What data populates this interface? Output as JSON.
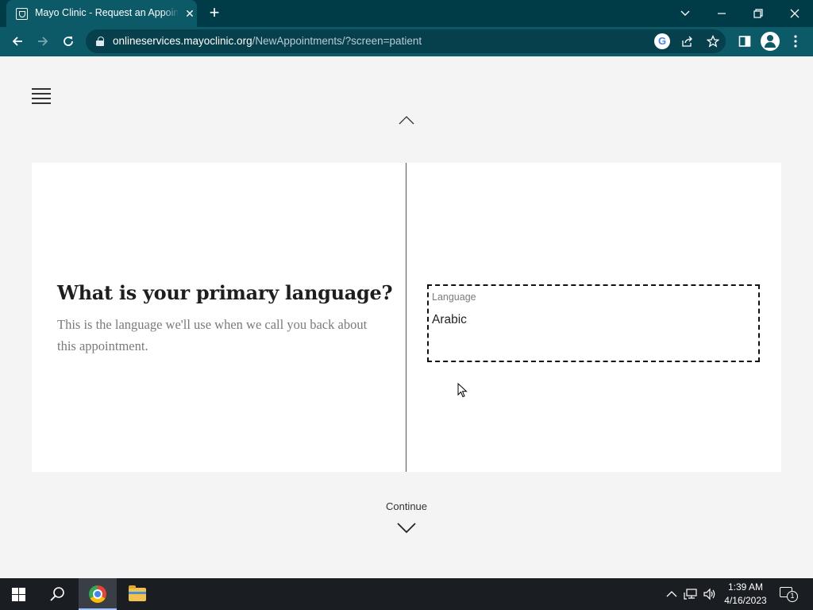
{
  "browser": {
    "tab": {
      "title": "Mayo Clinic - Request an Appointment",
      "favicon": "mayo-clinic-shield-icon"
    },
    "new_tab_icon": "plus-icon",
    "window_controls": [
      "chevron-down-icon",
      "minimize-icon",
      "restore-icon",
      "close-icon"
    ],
    "toolbar": {
      "url_host": "onlineservices.mayoclinic.org",
      "url_path": "/NewAppointments/?screen=patient",
      "icons": [
        "back-arrow-icon",
        "forward-arrow-icon",
        "reload-icon",
        "lock-icon",
        "google-icon",
        "share-icon",
        "star-icon",
        "side-panel-icon",
        "profile-icon",
        "more-icon"
      ]
    },
    "colors": {
      "frame": "#003b48",
      "toolbar": "#0c5a68",
      "omnibox": "#06404d"
    }
  },
  "page": {
    "menu_icon": "hamburger-menu-icon",
    "question": "What is your primary language?",
    "helper_text": "This is the language we'll use when we call you back about this appointment.",
    "language_field": {
      "label": "Language",
      "value": "Arabic"
    },
    "continue_label": "Continue"
  },
  "taskbar": {
    "apps": [
      "windows-start-icon",
      "search-icon",
      "chrome-icon",
      "file-explorer-icon"
    ],
    "tray_icons": [
      "chevron-up-icon",
      "network-icon",
      "volume-icon"
    ],
    "time": "1:39 AM",
    "date": "4/16/2023",
    "notification_count": "1"
  }
}
